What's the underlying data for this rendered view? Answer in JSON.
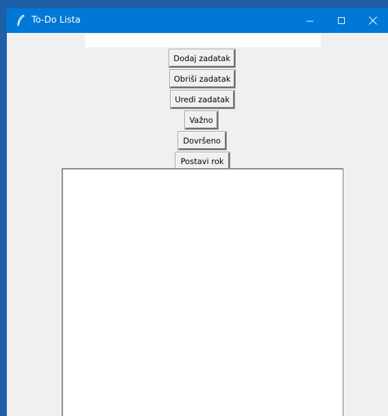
{
  "window": {
    "title": "To-Do Lista",
    "titlebar_color": "#0078d7",
    "background_color": "#f0f0f0",
    "controls": [
      "minimize-icon",
      "maximize-icon",
      "close-icon"
    ]
  },
  "entry": {
    "value": ""
  },
  "buttons": {
    "add": "Dodaj zadatak",
    "delete": "Obriši zadatak",
    "edit": "Uredi zadatak",
    "important": "Važno",
    "done": "Dovršeno",
    "deadline": "Postavi rok"
  },
  "task_list": {
    "items": []
  }
}
